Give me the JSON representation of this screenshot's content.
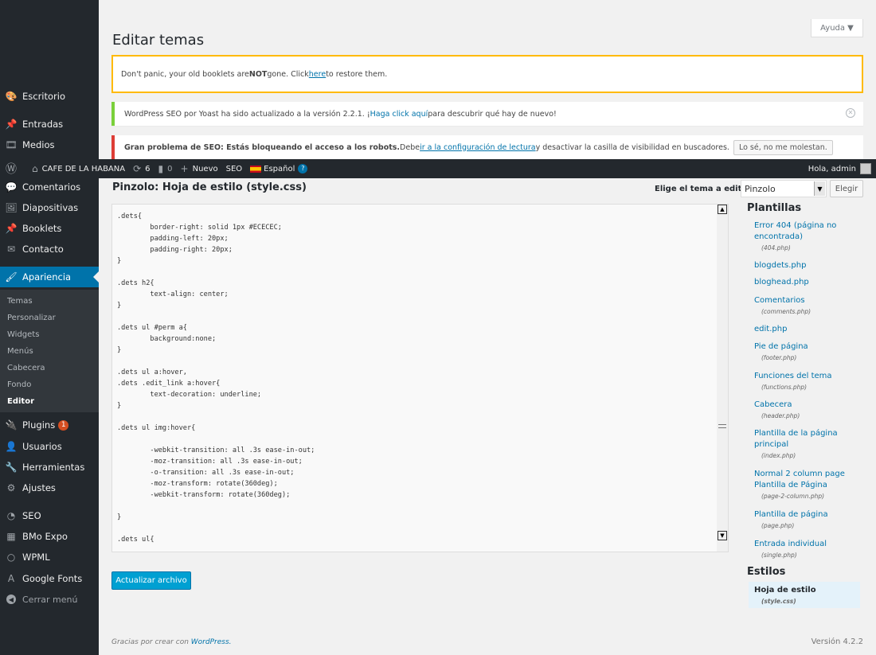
{
  "page_title": "Editar temas",
  "help_tab": "Ayuda ▼",
  "notices": {
    "booklets": {
      "before": "Don't panic, your old booklets are ",
      "bold": "NOT",
      "middle": " gone. Click ",
      "link": "here",
      "after": " to restore them."
    },
    "yoast": {
      "before": "WordPress SEO por Yoast ha sido actualizado a la versión 2.2.1. ¡",
      "link": "Haga click aquí",
      "after": " para descubrir qué hay de nuevo!"
    },
    "seo": {
      "bold": "Gran problema de SEO: Estás bloqueando el acceso a los robots.",
      "before": " Debe ",
      "link": "ir a la configuración de lectura",
      "after": " y desactivar la casilla de visibilidad en buscadores.",
      "button": "Lo sé, no me molestan."
    }
  },
  "admin_bar": {
    "site": "CAFE DE LA HABANA",
    "updates": "6",
    "comments": "0",
    "new": "Nuevo",
    "seo": "SEO",
    "language": "Español",
    "greeting": "Hola, admin"
  },
  "sidebar": {
    "items": [
      {
        "label": "Escritorio",
        "icon": "dashboard-icon",
        "glyph": "🎨"
      },
      {
        "label": "Entradas",
        "icon": "pin-icon",
        "glyph": "📌"
      },
      {
        "label": "Medios",
        "icon": "media-icon",
        "glyph": "🎞"
      },
      {
        "label": "Comentarios",
        "icon": "comments-icon",
        "glyph": "💬"
      },
      {
        "label": "Diapositivas",
        "icon": "slides-icon",
        "glyph": "🖼"
      },
      {
        "label": "Booklets",
        "icon": "pin-icon",
        "glyph": "📌"
      },
      {
        "label": "Contacto",
        "icon": "mail-icon",
        "glyph": "✉"
      },
      {
        "label": "Apariencia",
        "icon": "brush-icon",
        "glyph": "🖌"
      }
    ],
    "submenu": [
      "Temas",
      "Personalizar",
      "Widgets",
      "Menús",
      "Cabecera",
      "Fondo",
      "Editor"
    ],
    "items_bottom": [
      {
        "label": "Plugins",
        "icon": "plugin-icon",
        "glyph": "🔌",
        "badge": "1"
      },
      {
        "label": "Usuarios",
        "icon": "users-icon",
        "glyph": "👤"
      },
      {
        "label": "Herramientas",
        "icon": "wrench-icon",
        "glyph": "🔧"
      },
      {
        "label": "Ajustes",
        "icon": "settings-icon",
        "glyph": "⚙"
      },
      {
        "label": "SEO",
        "icon": "seo-icon",
        "glyph": "◔"
      },
      {
        "label": "BMo Expo",
        "icon": "expo-icon",
        "glyph": "▦"
      },
      {
        "label": "WPML",
        "icon": "wpml-icon",
        "glyph": "○"
      },
      {
        "label": "Google Fonts",
        "icon": "font-icon",
        "glyph": "A"
      }
    ],
    "collapse": "Cerrar menú"
  },
  "editor": {
    "file_title": "Pinzolo: Hoja de estilo (style.css)",
    "select_label": "Elige el tema a editar:",
    "selected_theme": "Pinzolo",
    "choose_button": "Elegir",
    "code": ".dets{\n        border-right: solid 1px #ECECEC;\n        padding-left: 20px;\n        padding-right: 20px;\n}\n\n.dets h2{\n        text-align: center;\n}\n\n.dets ul #perm a{\n        background:none;\n}\n\n.dets ul a:hover,\n.dets .edit_link a:hover{\n        text-decoration: underline;\n}\n\n.dets ul img:hover{\n\n        -webkit-transition: all .3s ease-in-out;\n        -moz-transition: all .3s ease-in-out;\n        -o-transition: all .3s ease-in-out;\n        -moz-transform: rotate(360deg);\n        -webkit-transform: rotate(360deg);\n\n}\n\n.dets ul{",
    "update_button": "Actualizar archivo"
  },
  "templates": {
    "heading": "Plantillas",
    "items": [
      {
        "label": "Error 404 (página no encontrada)",
        "file": "(404.php)"
      },
      {
        "label": "blogdets.php",
        "file": ""
      },
      {
        "label": "bloghead.php",
        "file": ""
      },
      {
        "label": "Comentarios",
        "file": "(comments.php)"
      },
      {
        "label": "edit.php",
        "file": ""
      },
      {
        "label": "Pie de página",
        "file": "(footer.php)"
      },
      {
        "label": "Funciones del tema",
        "file": "(functions.php)"
      },
      {
        "label": "Cabecera",
        "file": "(header.php)"
      },
      {
        "label": "Plantilla de la página principal",
        "file": "(index.php)"
      },
      {
        "label": "Normal 2 column page Plantilla de Página",
        "file": "(page-2-column.php)"
      },
      {
        "label": "Plantilla de página",
        "file": "(page.php)"
      },
      {
        "label": "Entrada individual",
        "file": "(single.php)"
      }
    ],
    "styles_heading": "Estilos",
    "style_item": {
      "label": "Hoja de estilo",
      "file": "(style.css)"
    }
  },
  "footer": {
    "thanks": "Gracias por crear con ",
    "link": "WordPress.",
    "version": "Versión 4.2.2"
  }
}
